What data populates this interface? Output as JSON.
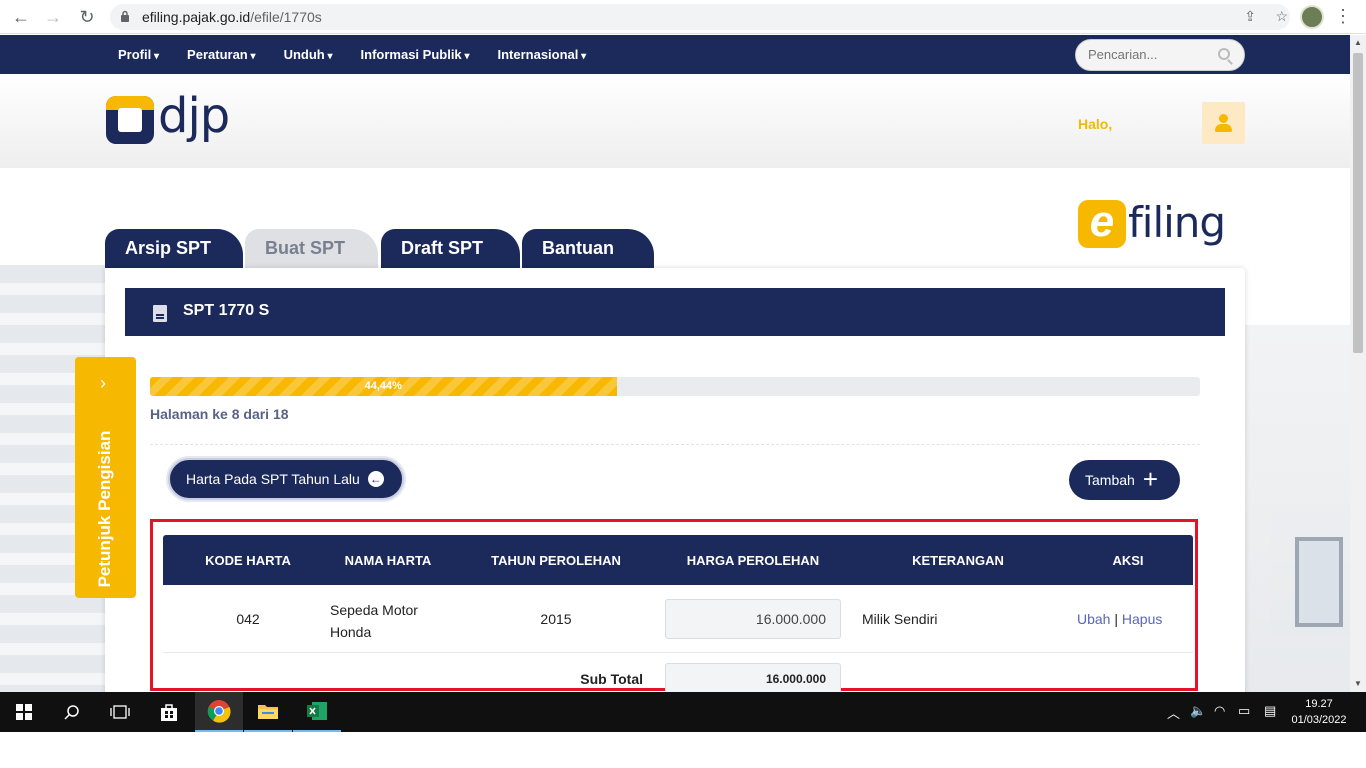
{
  "browser": {
    "url_host": "efiling.pajak.go.id",
    "url_path": "/efile/1770s"
  },
  "topnav": {
    "items": [
      "Profil",
      "Peraturan",
      "Unduh",
      "Informasi Publik",
      "Internasional"
    ],
    "search_placeholder": "Pencarian..."
  },
  "header": {
    "logo_text": "djp",
    "greeting": "Halo,"
  },
  "efiling_logo": {
    "e": "e",
    "text": "filing"
  },
  "tabs": [
    "Arsip SPT",
    "Buat SPT",
    "Draft SPT",
    "Bantuan"
  ],
  "active_tab": "Buat SPT",
  "card": {
    "title": "SPT 1770 S",
    "progress": {
      "percent": 44.44,
      "label": "44,44%"
    },
    "page_info": "Halaman ke 8 dari 18",
    "prev_button": "Harta Pada SPT Tahun Lalu",
    "add_button": "Tambah"
  },
  "table": {
    "headers": [
      "KODE HARTA",
      "NAMA HARTA",
      "TAHUN PEROLEHAN",
      "HARGA PEROLEHAN",
      "KETERANGAN",
      "AKSI"
    ],
    "rows": [
      {
        "kode": "042",
        "nama": "Sepeda Motor Honda",
        "tahun": "2015",
        "harga": "16.000.000",
        "keterangan": "Milik Sendiri",
        "aksi_edit": "Ubah",
        "aksi_sep": "|",
        "aksi_delete": "Hapus"
      }
    ],
    "subtotal_label": "Sub Total",
    "subtotal_value": "16.000.000"
  },
  "side_tab": {
    "label": "Petunjuk Pengisian"
  },
  "taskbar": {
    "time": "19.27",
    "date": "01/03/2022"
  },
  "colors": {
    "navy": "#1b2a5b",
    "yellow": "#f6b800",
    "highlight_red": "#e3132a",
    "link": "#5a65b8"
  }
}
